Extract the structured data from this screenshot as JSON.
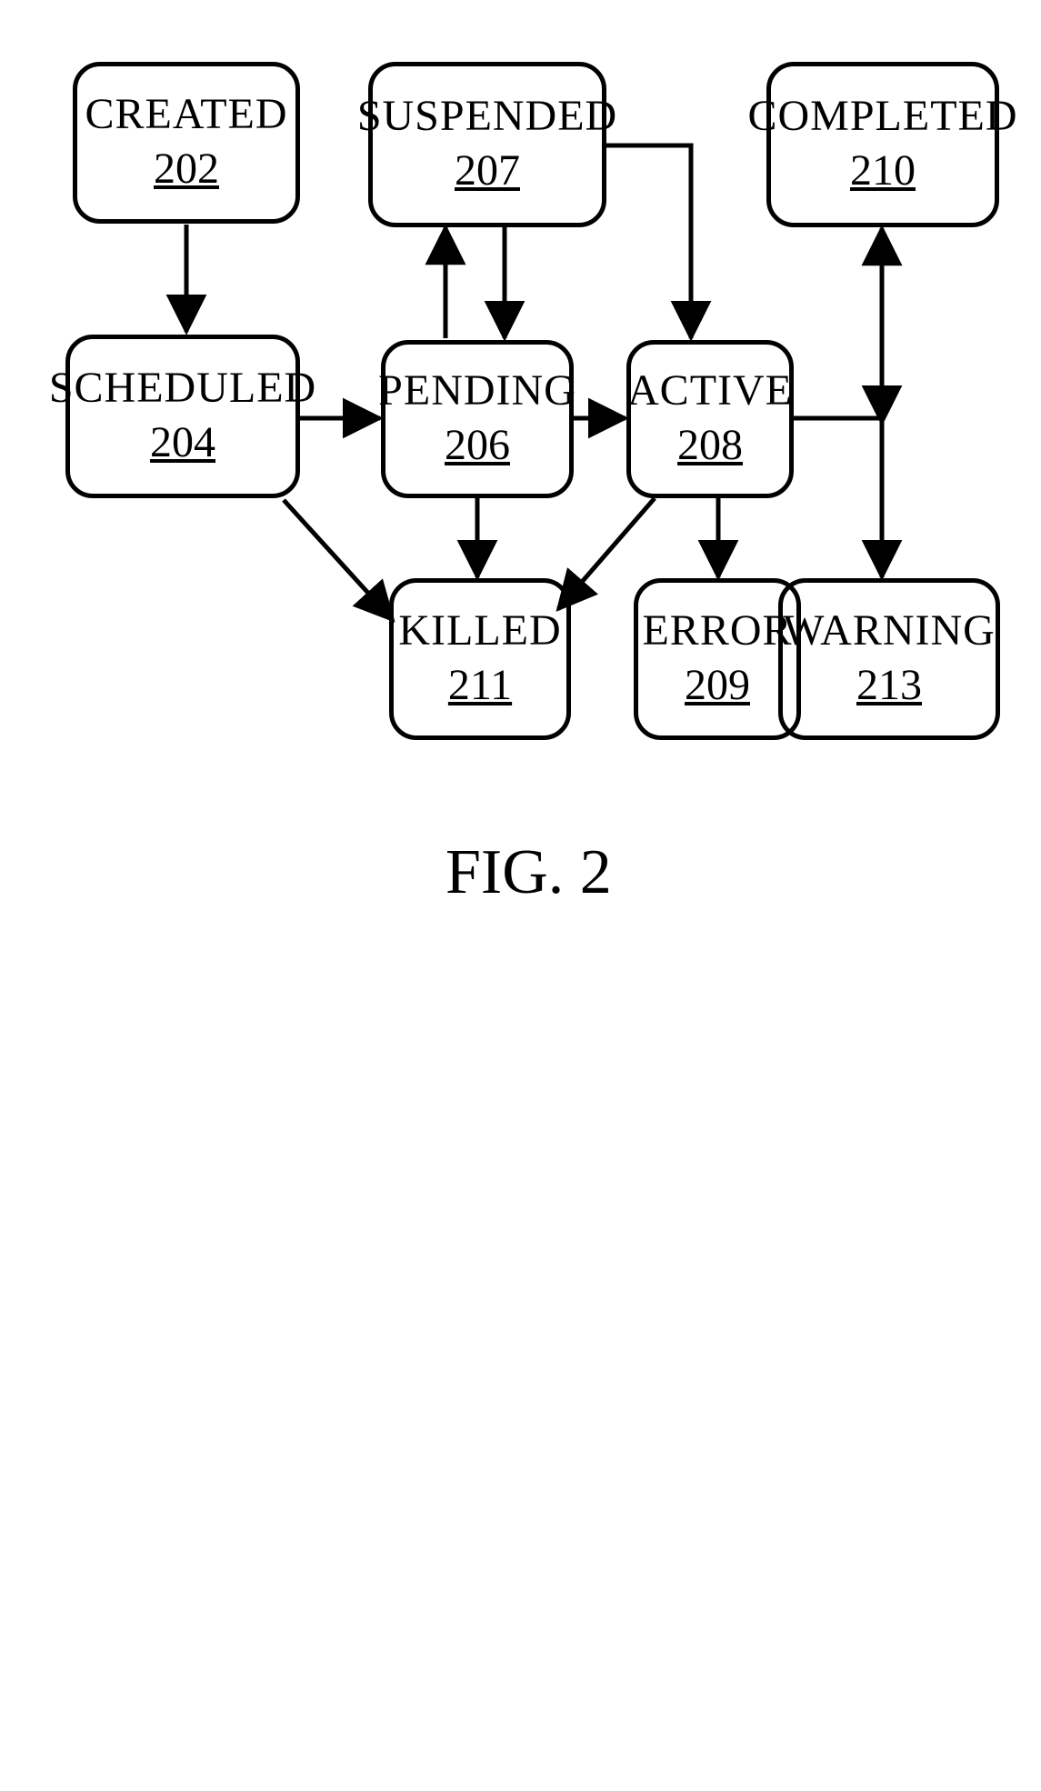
{
  "figure_label": "FIG. 2",
  "nodes": {
    "created": {
      "label": "CREATED",
      "num": "202"
    },
    "scheduled": {
      "label": "SCHEDULED",
      "num": "204"
    },
    "pending": {
      "label": "PENDING",
      "num": "206"
    },
    "suspended": {
      "label": "SUSPENDED",
      "num": "207"
    },
    "active": {
      "label": "ACTIVE",
      "num": "208"
    },
    "error": {
      "label": "ERROR",
      "num": "209"
    },
    "completed": {
      "label": "COMPLETED",
      "num": "210"
    },
    "killed": {
      "label": "KILLED",
      "num": "211"
    },
    "warning": {
      "label": "WARNING",
      "num": "213"
    }
  },
  "diagram": {
    "type": "state-diagram",
    "edges": [
      {
        "from": "created",
        "to": "scheduled"
      },
      {
        "from": "scheduled",
        "to": "pending"
      },
      {
        "from": "scheduled",
        "to": "killed"
      },
      {
        "from": "pending",
        "to": "suspended",
        "bidirectional": true
      },
      {
        "from": "suspended",
        "to": "active"
      },
      {
        "from": "pending",
        "to": "active"
      },
      {
        "from": "pending",
        "to": "killed"
      },
      {
        "from": "active",
        "to": "killed"
      },
      {
        "from": "active",
        "to": "error"
      },
      {
        "from": "active",
        "to": "completed",
        "bidirectional": true
      },
      {
        "from": "active",
        "to": "warning"
      }
    ]
  }
}
